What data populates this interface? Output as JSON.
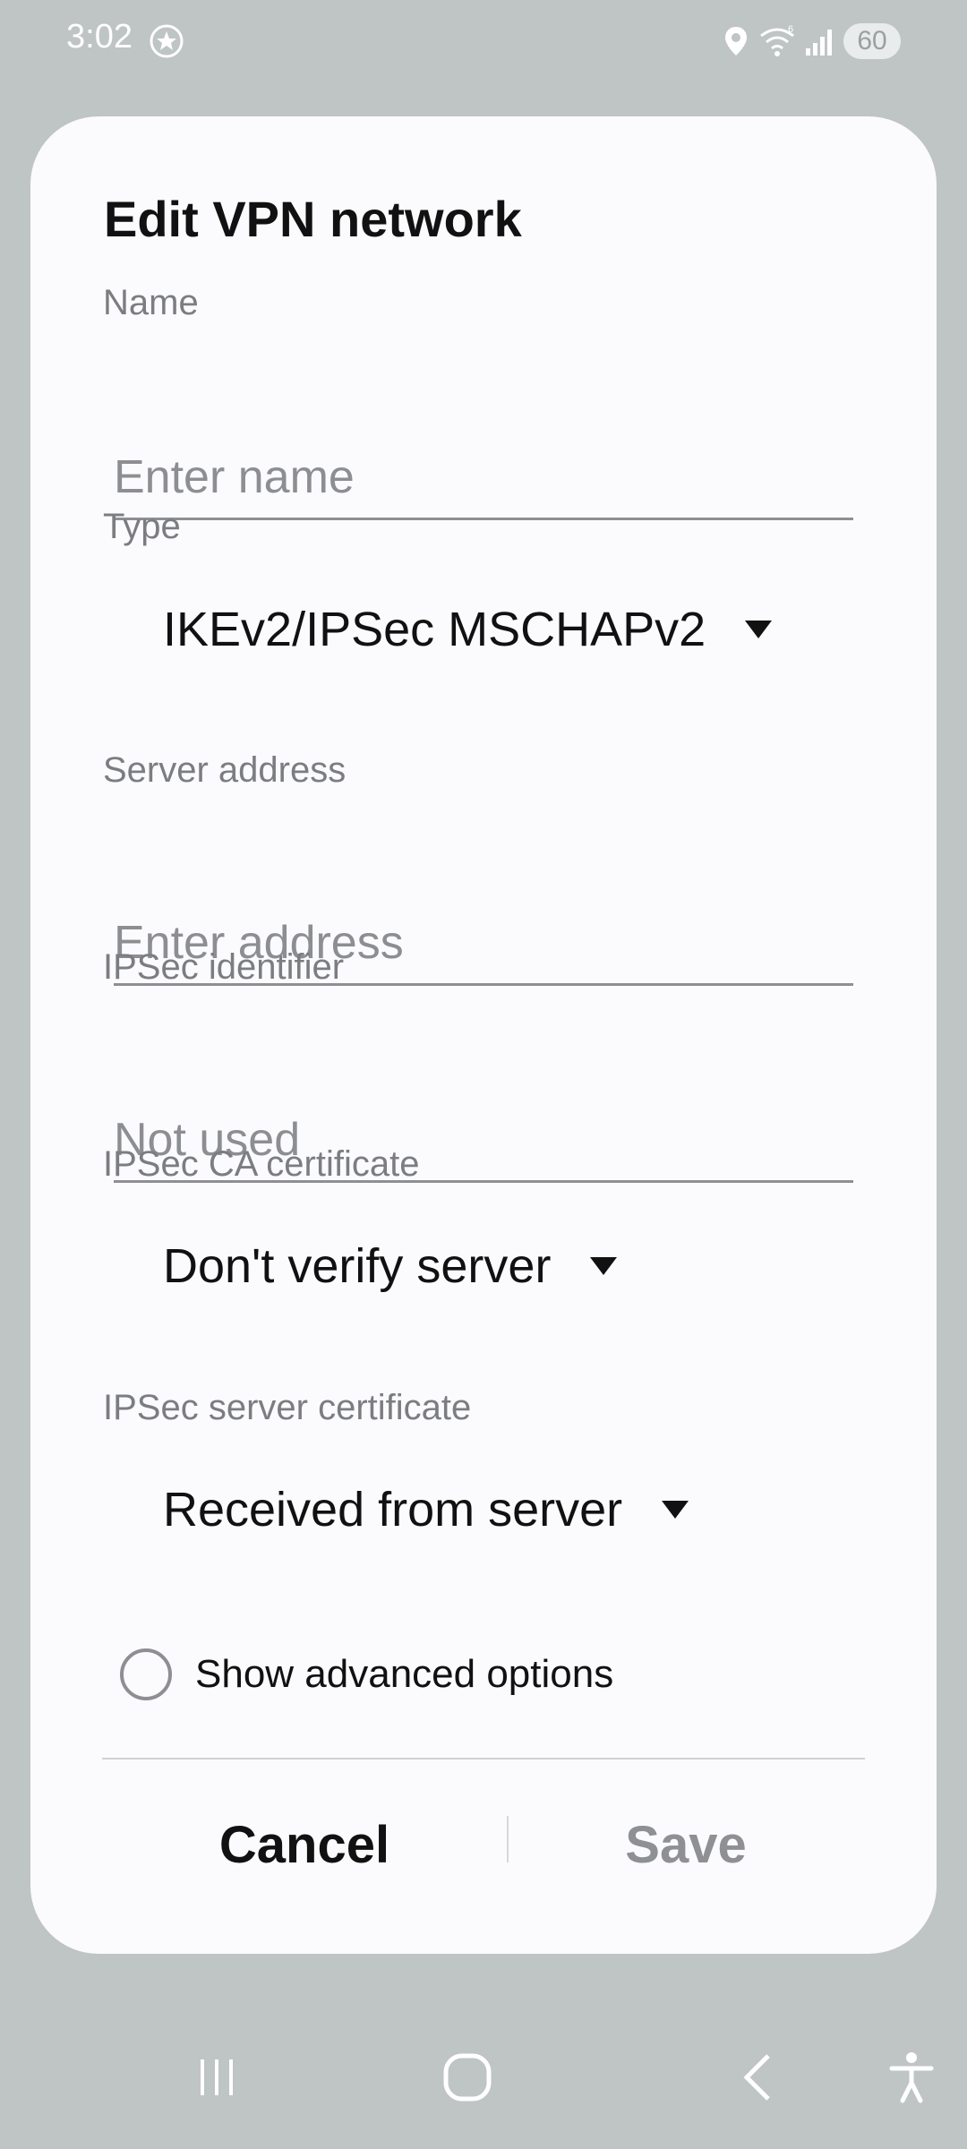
{
  "status_bar": {
    "time": "3:02",
    "battery": "60"
  },
  "dialog": {
    "title": "Edit VPN network",
    "name": {
      "label": "Name",
      "placeholder": "Enter name",
      "value": ""
    },
    "type": {
      "label": "Type",
      "value": "IKEv2/IPSec MSCHAPv2"
    },
    "server_address": {
      "label": "Server address",
      "placeholder": "Enter address",
      "value": ""
    },
    "ipsec_identifier": {
      "label": "IPSec identifier",
      "placeholder": "Not used",
      "value": ""
    },
    "ipsec_ca_certificate": {
      "label": "IPSec CA certificate",
      "value": "Don't verify server"
    },
    "ipsec_server_certificate": {
      "label": "IPSec server certificate",
      "value": "Received from server"
    },
    "advanced_options": {
      "label": "Show advanced options",
      "checked": false
    },
    "cancel_label": "Cancel",
    "save_label": "Save"
  },
  "icons": {
    "status": [
      "star-icon",
      "location-icon",
      "wifi-icon",
      "signal-icon"
    ],
    "nav": [
      "recent-apps-icon",
      "home-icon",
      "back-icon",
      "accessibility-icon"
    ]
  },
  "colors": {
    "backdrop": "#bfc4c4",
    "dialog": "#fbfbfd",
    "text": "#111111",
    "label": "#7b7d80",
    "disabled": "#8e9093"
  }
}
